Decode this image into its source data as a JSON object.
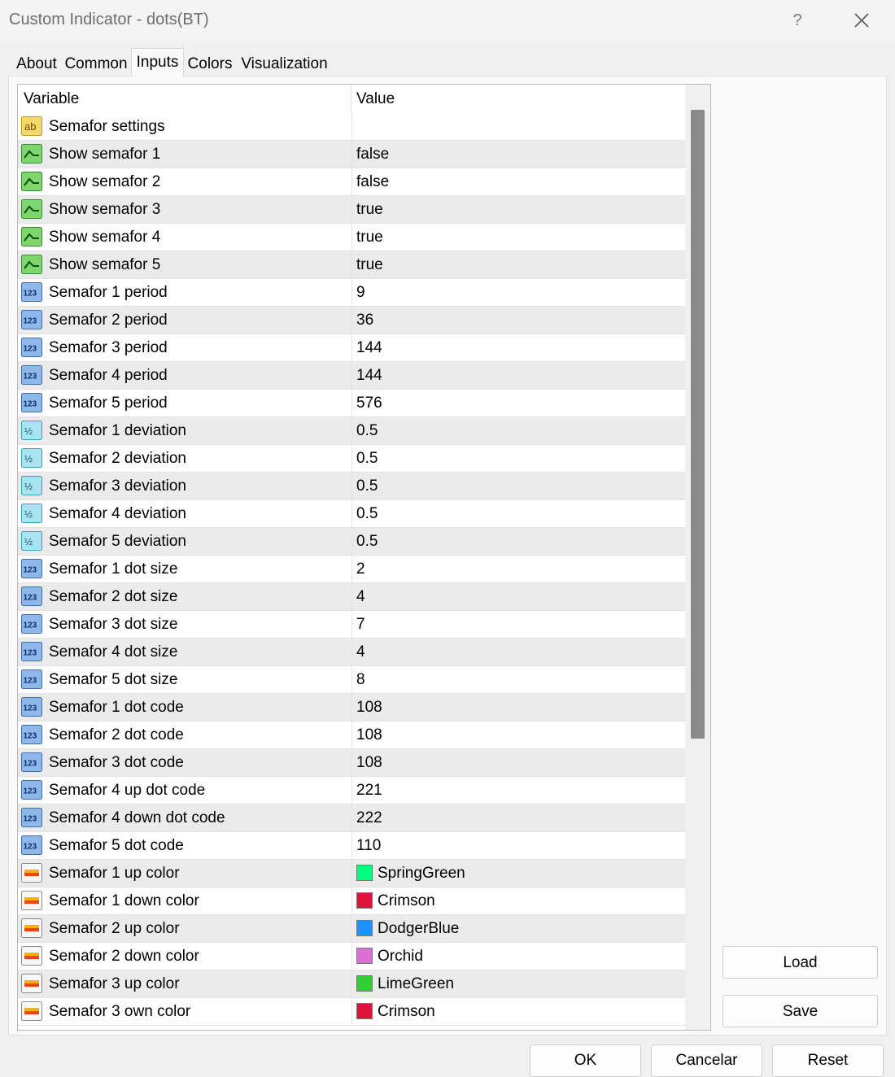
{
  "window": {
    "title": "Custom Indicator - dots(BT)",
    "help": "?"
  },
  "tabs": [
    {
      "label": "About"
    },
    {
      "label": "Common"
    },
    {
      "label": "Inputs"
    },
    {
      "label": "Colors"
    },
    {
      "label": "Visualization"
    }
  ],
  "active_tab": "Inputs",
  "grid": {
    "headers": {
      "variable": "Variable",
      "value": "Value"
    },
    "rows": [
      {
        "icon": "text-ab-icon",
        "name": "Semafor settings",
        "value": ""
      },
      {
        "icon": "boolean-icon",
        "name": "Show semafor 1",
        "value": "false"
      },
      {
        "icon": "boolean-icon",
        "name": "Show semafor 2",
        "value": "false"
      },
      {
        "icon": "boolean-icon",
        "name": "Show semafor 3",
        "value": "true"
      },
      {
        "icon": "boolean-icon",
        "name": "Show semafor 4",
        "value": "true"
      },
      {
        "icon": "boolean-icon",
        "name": "Show semafor 5",
        "value": "true"
      },
      {
        "icon": "integer-icon",
        "name": "Semafor 1 period",
        "value": "9"
      },
      {
        "icon": "integer-icon",
        "name": "Semafor 2 period",
        "value": "36"
      },
      {
        "icon": "integer-icon",
        "name": "Semafor 3 period",
        "value": "144"
      },
      {
        "icon": "integer-icon",
        "name": "Semafor 4 period",
        "value": "144"
      },
      {
        "icon": "integer-icon",
        "name": "Semafor 5 period",
        "value": "576"
      },
      {
        "icon": "double-icon",
        "name": "Semafor 1 deviation",
        "value": "0.5"
      },
      {
        "icon": "double-icon",
        "name": "Semafor 2 deviation",
        "value": "0.5"
      },
      {
        "icon": "double-icon",
        "name": "Semafor 3 deviation",
        "value": "0.5"
      },
      {
        "icon": "double-icon",
        "name": "Semafor 4 deviation",
        "value": "0.5"
      },
      {
        "icon": "double-icon",
        "name": "Semafor 5 deviation",
        "value": "0.5"
      },
      {
        "icon": "integer-icon",
        "name": "Semafor 1 dot size",
        "value": "2"
      },
      {
        "icon": "integer-icon",
        "name": "Semafor 2 dot size",
        "value": "4"
      },
      {
        "icon": "integer-icon",
        "name": "Semafor 3 dot size",
        "value": "7"
      },
      {
        "icon": "integer-icon",
        "name": "Semafor 4 dot size",
        "value": "4"
      },
      {
        "icon": "integer-icon",
        "name": "Semafor 5 dot size",
        "value": "8"
      },
      {
        "icon": "integer-icon",
        "name": "Semafor 1 dot code",
        "value": "108"
      },
      {
        "icon": "integer-icon",
        "name": "Semafor 2 dot code",
        "value": "108"
      },
      {
        "icon": "integer-icon",
        "name": "Semafor 3 dot code",
        "value": "108"
      },
      {
        "icon": "integer-icon",
        "name": "Semafor 4 up dot code",
        "value": "221"
      },
      {
        "icon": "integer-icon",
        "name": "Semafor 4 down dot code",
        "value": "222"
      },
      {
        "icon": "integer-icon",
        "name": "Semafor 5 dot code",
        "value": "110"
      },
      {
        "icon": "color-icon",
        "name": "Semafor 1 up color",
        "value": "SpringGreen",
        "swatch": "#00ff7f"
      },
      {
        "icon": "color-icon",
        "name": "Semafor 1 down color",
        "value": "Crimson",
        "swatch": "#dc143c"
      },
      {
        "icon": "color-icon",
        "name": "Semafor 2 up color",
        "value": "DodgerBlue",
        "swatch": "#1e90ff"
      },
      {
        "icon": "color-icon",
        "name": "Semafor 2 down color",
        "value": "Orchid",
        "swatch": "#da70d6"
      },
      {
        "icon": "color-icon",
        "name": "Semafor 3 up color",
        "value": "LimeGreen",
        "swatch": "#32cd32"
      },
      {
        "icon": "color-icon",
        "name": "Semafor 3 own color",
        "value": "Crimson",
        "swatch": "#dc143c"
      }
    ]
  },
  "side_buttons": {
    "load": "Load",
    "save": "Save"
  },
  "footer": {
    "ok": "OK",
    "cancel": "Cancelar",
    "reset": "Reset"
  }
}
